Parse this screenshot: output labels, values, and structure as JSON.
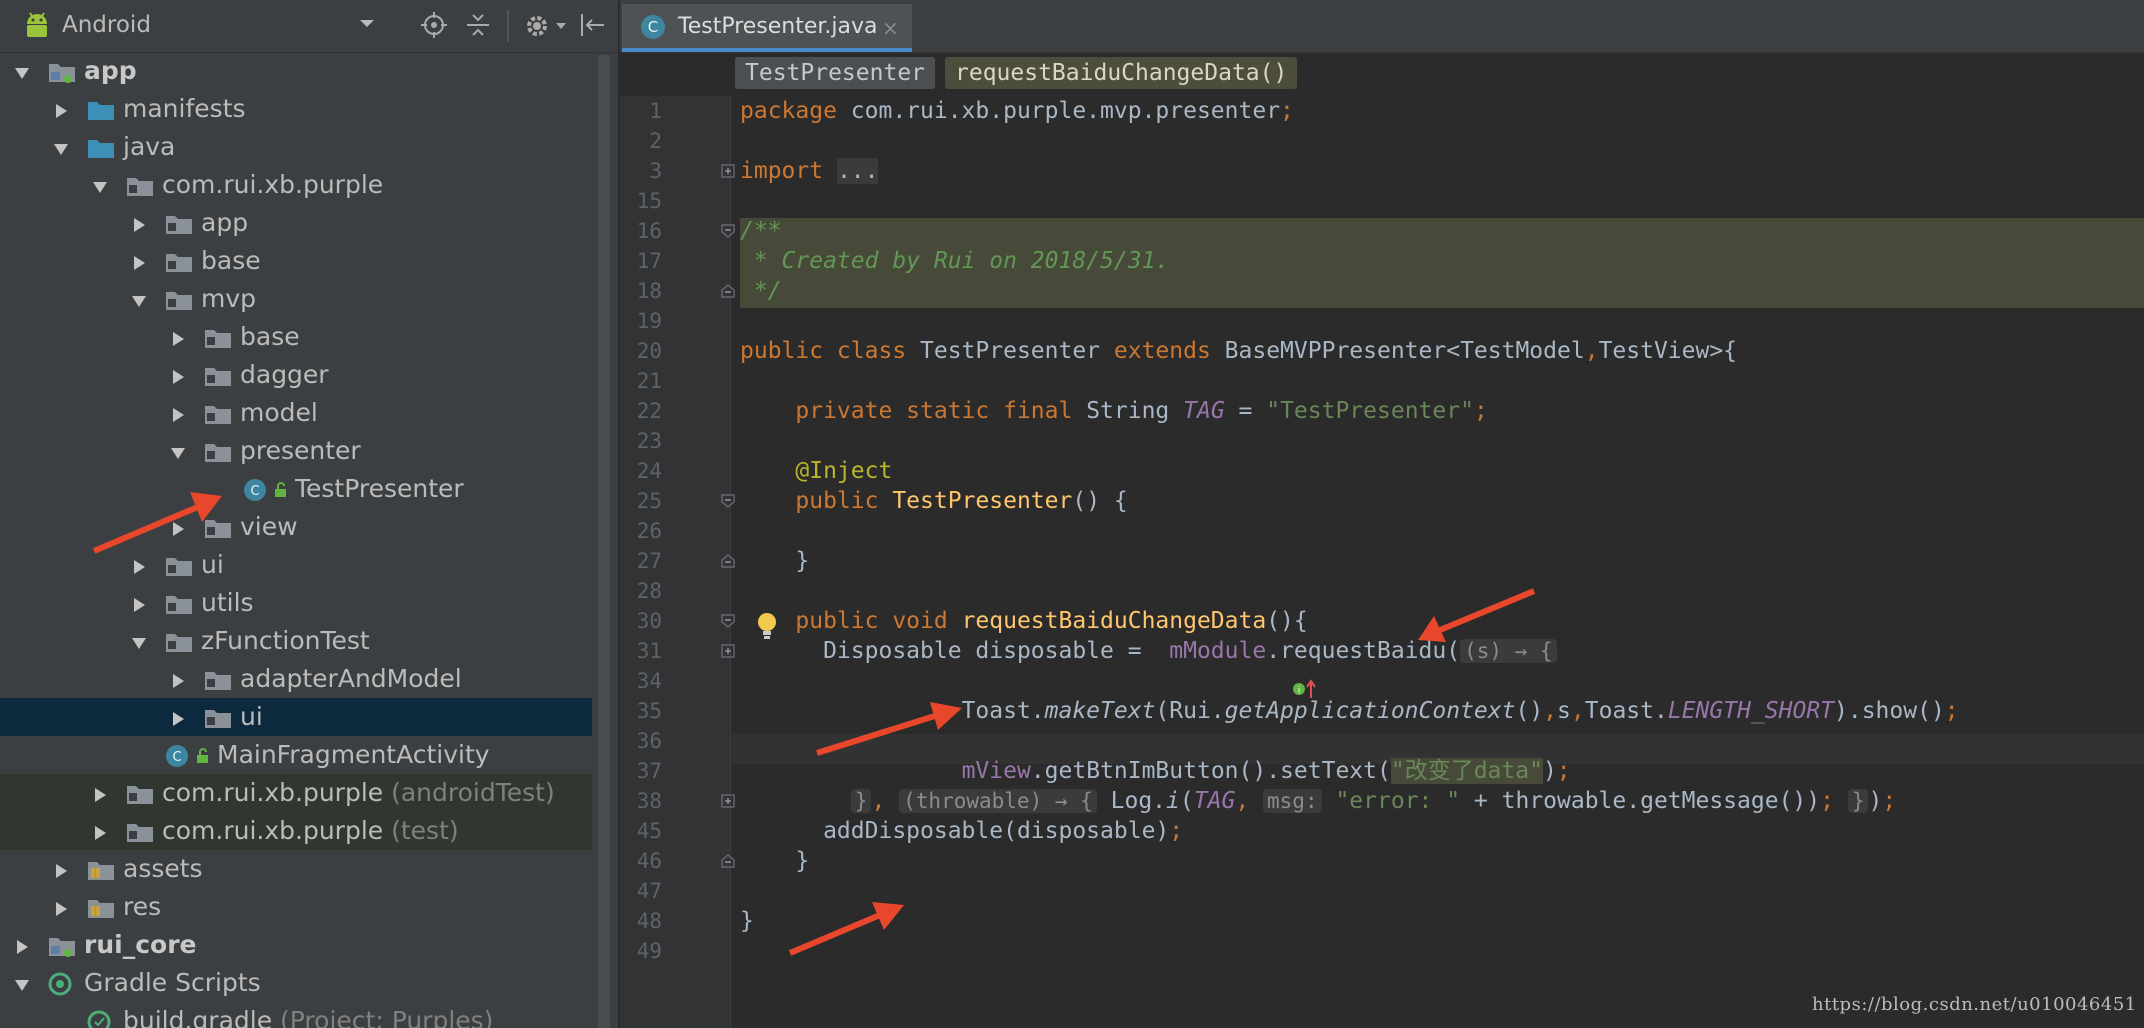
{
  "project_panel": {
    "view_selector": "Android",
    "tree": [
      {
        "label": "app",
        "suffix": "",
        "depth": 0,
        "expanded": true,
        "icon": "module-folder-icon",
        "bold": true
      },
      {
        "label": "manifests",
        "suffix": "",
        "depth": 1,
        "expanded": false,
        "icon": "folder-icon"
      },
      {
        "label": "java",
        "suffix": "",
        "depth": 1,
        "expanded": true,
        "icon": "folder-icon"
      },
      {
        "label": "com.rui.xb.purple",
        "suffix": "",
        "depth": 2,
        "expanded": true,
        "icon": "package-icon"
      },
      {
        "label": "app",
        "suffix": "",
        "depth": 3,
        "expanded": false,
        "icon": "package-icon"
      },
      {
        "label": "base",
        "suffix": "",
        "depth": 3,
        "expanded": false,
        "icon": "package-icon"
      },
      {
        "label": "mvp",
        "suffix": "",
        "depth": 3,
        "expanded": true,
        "icon": "package-icon"
      },
      {
        "label": "base",
        "suffix": "",
        "depth": 4,
        "expanded": false,
        "icon": "package-icon"
      },
      {
        "label": "dagger",
        "suffix": "",
        "depth": 4,
        "expanded": false,
        "icon": "package-icon"
      },
      {
        "label": "model",
        "suffix": "",
        "depth": 4,
        "expanded": false,
        "icon": "package-icon"
      },
      {
        "label": "presenter",
        "suffix": "",
        "depth": 4,
        "expanded": true,
        "icon": "package-icon"
      },
      {
        "label": "TestPresenter",
        "suffix": "",
        "depth": 5,
        "expanded": null,
        "icon": "class-icon"
      },
      {
        "label": "view",
        "suffix": "",
        "depth": 4,
        "expanded": false,
        "icon": "package-icon"
      },
      {
        "label": "ui",
        "suffix": "",
        "depth": 3,
        "expanded": false,
        "icon": "package-icon"
      },
      {
        "label": "utils",
        "suffix": "",
        "depth": 3,
        "expanded": false,
        "icon": "package-icon"
      },
      {
        "label": "zFunctionTest",
        "suffix": "",
        "depth": 3,
        "expanded": true,
        "icon": "package-icon"
      },
      {
        "label": "adapterAndModel",
        "suffix": "",
        "depth": 4,
        "expanded": false,
        "icon": "package-icon"
      },
      {
        "label": "ui",
        "suffix": "",
        "depth": 4,
        "expanded": false,
        "icon": "package-icon",
        "selected": true
      },
      {
        "label": "MainFragmentActivity",
        "suffix": "",
        "depth": 3,
        "expanded": null,
        "icon": "class-icon"
      },
      {
        "label": "com.rui.xb.purple",
        "suffix": " (androidTest)",
        "depth": 2,
        "expanded": false,
        "icon": "package-icon",
        "green": true
      },
      {
        "label": "com.rui.xb.purple",
        "suffix": " (test)",
        "depth": 2,
        "expanded": false,
        "icon": "package-icon",
        "green": true
      },
      {
        "label": "assets",
        "suffix": "",
        "depth": 1,
        "expanded": false,
        "icon": "resource-folder-icon"
      },
      {
        "label": "res",
        "suffix": "",
        "depth": 1,
        "expanded": false,
        "icon": "resource-folder-icon"
      },
      {
        "label": "rui_core",
        "suffix": "",
        "depth": 0,
        "expanded": false,
        "icon": "module-folder-icon",
        "bold": true
      },
      {
        "label": "Gradle Scripts",
        "suffix": "",
        "depth": 0,
        "expanded": true,
        "icon": "gradle-icon"
      },
      {
        "label": "build.gradle",
        "suffix": " (Project: Purples)",
        "depth": 1,
        "expanded": null,
        "icon": "gradle-file-icon"
      }
    ]
  },
  "editor": {
    "tab": {
      "label": "TestPresenter.java",
      "close": "×"
    },
    "breadcrumbs": [
      "TestPresenter",
      "requestBaiduChangeData()"
    ],
    "lines": [
      {
        "n": "1",
        "t": [
          [
            "kw",
            "package "
          ],
          [
            "",
            "com.rui.xb.purple.mvp.presenter"
          ],
          [
            "kw",
            ";"
          ]
        ]
      },
      {
        "n": "2",
        "t": []
      },
      {
        "n": "3",
        "t": [
          [
            "kw",
            "import "
          ],
          [
            "fold-txt",
            "..."
          ]
        ]
      },
      {
        "n": "15",
        "t": []
      },
      {
        "n": "16",
        "t": [
          [
            "cmt",
            "/**"
          ]
        ]
      },
      {
        "n": "17",
        "t": [
          [
            "cmt",
            " * Created by Rui on 2018/5/31."
          ]
        ]
      },
      {
        "n": "18",
        "t": [
          [
            "cmt",
            " */"
          ]
        ]
      },
      {
        "n": "19",
        "t": []
      },
      {
        "n": "20",
        "t": [
          [
            "kw",
            "public class "
          ],
          [
            "",
            "TestPresenter "
          ],
          [
            "kw",
            "extends "
          ],
          [
            "",
            "BaseMVPPresenter<TestModel"
          ],
          [
            "kw",
            ","
          ],
          [
            "",
            "TestView>{"
          ]
        ]
      },
      {
        "n": "21",
        "t": []
      },
      {
        "n": "22",
        "t": [
          [
            "",
            "    "
          ],
          [
            "kw",
            "private static final "
          ],
          [
            "",
            "String "
          ],
          [
            "ifld",
            "TAG"
          ],
          [
            "",
            " = "
          ],
          [
            "str",
            "\"TestPresenter\""
          ],
          [
            "kw",
            ";"
          ]
        ]
      },
      {
        "n": "23",
        "t": []
      },
      {
        "n": "24",
        "t": [
          [
            "",
            "    "
          ],
          [
            "ann",
            "@Inject"
          ]
        ]
      },
      {
        "n": "25",
        "t": [
          [
            "",
            "    "
          ],
          [
            "kw",
            "public "
          ],
          [
            "fn",
            "TestPresenter"
          ],
          [
            "",
            "() {"
          ]
        ]
      },
      {
        "n": "26",
        "t": []
      },
      {
        "n": "27",
        "t": [
          [
            "",
            "    }"
          ]
        ]
      },
      {
        "n": "28",
        "t": []
      },
      {
        "n": "30",
        "t": [
          [
            "",
            "    "
          ],
          [
            "kw",
            "public void "
          ],
          [
            "fn",
            "requestBaiduChangeData"
          ],
          [
            "",
            "(){"
          ]
        ]
      },
      {
        "n": "31",
        "t": [
          [
            "",
            "      Disposable disposable =  "
          ],
          [
            "fld",
            "mModule"
          ],
          [
            "",
            ".requestBaidu("
          ],
          [
            "hint",
            "(s) → {"
          ]
        ]
      },
      {
        "n": "34",
        "t": []
      },
      {
        "n": "35",
        "t": [
          [
            "",
            "                Toast."
          ],
          [
            "it",
            "makeText"
          ],
          [
            "",
            "(Rui."
          ],
          [
            "it",
            "getApplicationContext"
          ],
          [
            "",
            "()"
          ],
          [
            "kw",
            ","
          ],
          [
            "",
            "s"
          ],
          [
            "kw",
            ","
          ],
          [
            "",
            "Toast."
          ],
          [
            "ifld",
            "LENGTH_SHORT"
          ],
          [
            "",
            ").show()"
          ],
          [
            "kw",
            ";"
          ]
        ]
      },
      {
        "n": "36",
        "t": []
      },
      {
        "n": "37",
        "t": [
          [
            "",
            "                "
          ],
          [
            "fld",
            "mView"
          ],
          [
            "",
            ".getBtnImButton().setText("
          ],
          [
            "str hl-str",
            "\"改变了data\""
          ],
          [
            "",
            ")"
          ],
          [
            "kw",
            ";"
          ]
        ]
      },
      {
        "n": "38",
        "t": [
          [
            "",
            "        "
          ],
          [
            "hint",
            "}"
          ],
          [
            "kw",
            ", "
          ],
          [
            "hint",
            "(throwable) → {"
          ],
          [
            "",
            " Log."
          ],
          [
            "it",
            "i"
          ],
          [
            "",
            "("
          ],
          [
            "ifld",
            "TAG"
          ],
          [
            "kw",
            ", "
          ],
          [
            "",
            ""
          ],
          [
            "hint",
            "msg:"
          ],
          [
            "",
            " "
          ],
          [
            "str",
            "\"error: \""
          ],
          [
            "",
            " + throwable.getMessage())"
          ],
          [
            "kw",
            ";"
          ],
          [
            "",
            " "
          ],
          [
            "hint",
            "}"
          ],
          [
            "",
            ")"
          ],
          [
            "kw",
            ";"
          ]
        ]
      },
      {
        "n": "45",
        "t": [
          [
            "",
            "      addDisposable(disposable)"
          ],
          [
            "kw",
            ";"
          ]
        ]
      },
      {
        "n": "46",
        "t": [
          [
            "",
            "    }"
          ]
        ]
      },
      {
        "n": "47",
        "t": []
      },
      {
        "n": "48",
        "t": [
          [
            "",
            "}"
          ]
        ]
      },
      {
        "n": "49",
        "t": []
      }
    ]
  },
  "watermark": "https://blog.csdn.net/u010046451",
  "colors": {
    "arrow": "#e8472b",
    "accent": "#4a88c7",
    "keyword": "#cc7832",
    "string": "#6a8759"
  }
}
